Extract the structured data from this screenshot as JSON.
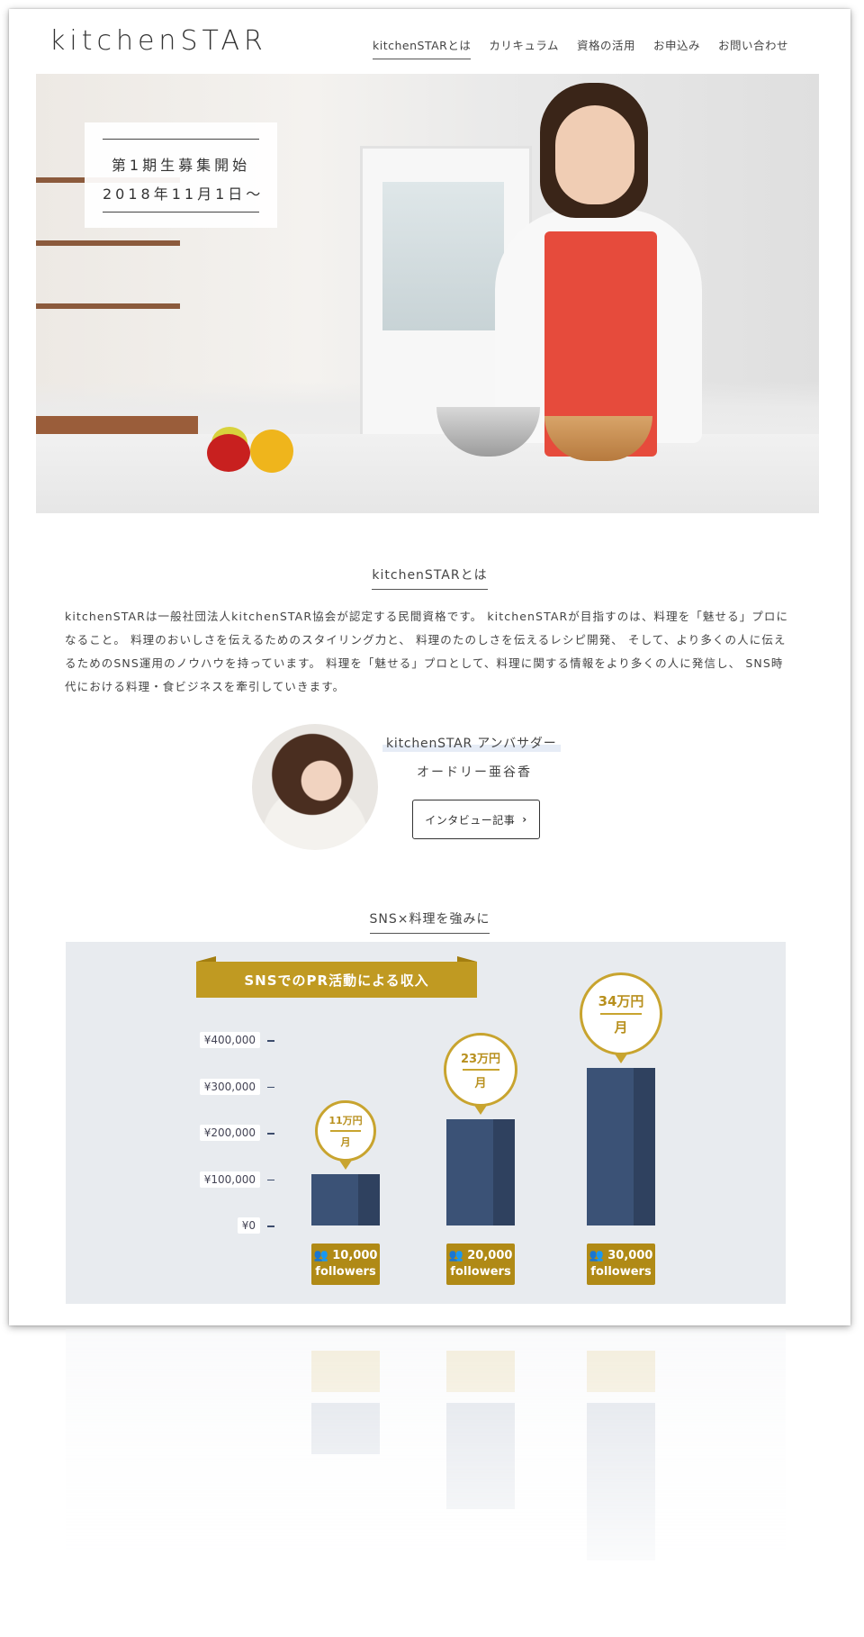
{
  "header": {
    "logo": "kitchenSTAR",
    "nav": [
      {
        "label": "kitchenSTARとは",
        "active": true
      },
      {
        "label": "カリキュラム",
        "active": false
      },
      {
        "label": "資格の活用",
        "active": false
      },
      {
        "label": "お申込み",
        "active": false
      },
      {
        "label": "お問い合わせ",
        "active": false
      }
    ]
  },
  "hero": {
    "badge_line1": "第1期生募集開始",
    "badge_line2": "2018年11月1日〜"
  },
  "about": {
    "title": "kitchenSTARとは",
    "text": "kitchenSTARは一般社団法人kitchenSTAR協会が認定する民間資格です。 kitchenSTARが目指すのは、料理を「魅せる」プロになること。 料理のおいしさを伝えるためのスタイリング力と、 料理のたのしさを伝えるレシピ開発、 そして、より多くの人に伝えるためのSNS運用のノウハウを持っています。 料理を「魅せる」プロとして、料理に関する情報をより多くの人に発信し、 SNS時代における料理・食ビジネスを牽引していきます。"
  },
  "ambassador": {
    "role": "kitchenSTAR アンバサダー",
    "name": "オードリー亜谷香",
    "button": "インタビュー記事"
  },
  "sns": {
    "title": "SNS×料理を強みに"
  },
  "chart_data": {
    "type": "bar",
    "title": "SNSでのPR活動による収入",
    "categories": [
      "10,000 followers",
      "20,000 followers",
      "30,000 followers"
    ],
    "follower_counts": [
      "10,000",
      "20,000",
      "30,000"
    ],
    "follower_unit": "followers",
    "values": [
      110000,
      230000,
      340000
    ],
    "bubble_amounts": [
      "11万円",
      "23万円",
      "34万円"
    ],
    "bubble_unit": "月",
    "yticks": [
      "¥400,000",
      "¥300,000",
      "¥200,000",
      "¥100,000",
      "¥0"
    ],
    "ylim": [
      0,
      400000
    ],
    "colors": {
      "bar": "#3b5276",
      "accent": "#c09a22"
    }
  }
}
